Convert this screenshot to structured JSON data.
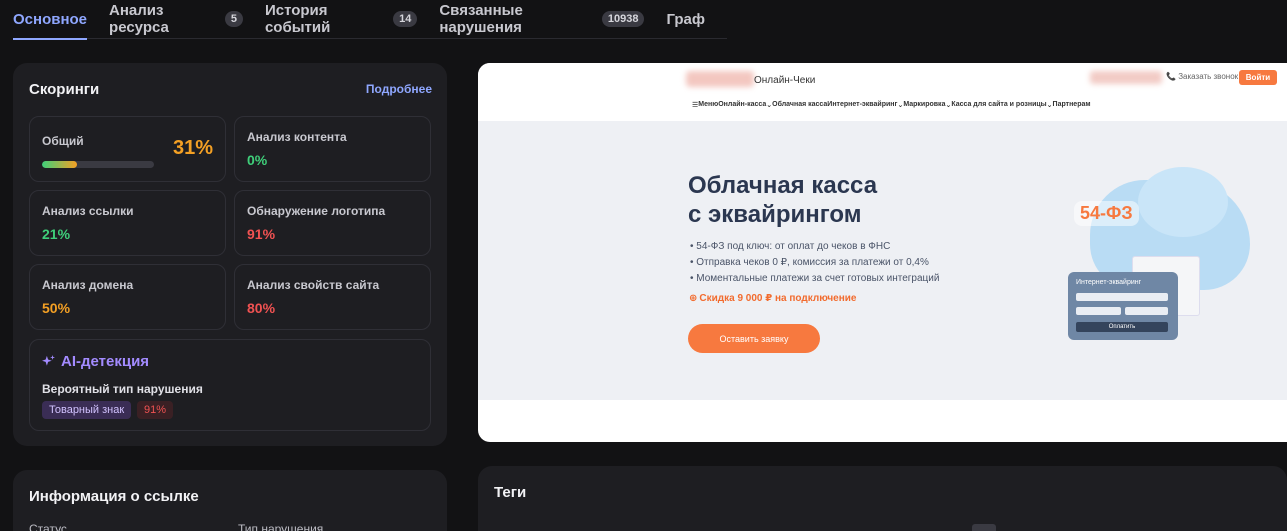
{
  "tabs": [
    {
      "label": "Основное",
      "count": null,
      "active": true
    },
    {
      "label": "Анализ ресурса",
      "count": "5"
    },
    {
      "label": "История событий",
      "count": "14"
    },
    {
      "label": "Связанные нарушения",
      "count": "10938"
    },
    {
      "label": "Граф",
      "count": null
    }
  ],
  "scoring": {
    "title": "Скоринги",
    "more_link": "Подробнее",
    "overall": {
      "label": "Общий",
      "value": "31%",
      "progress": 31
    },
    "content": {
      "label": "Анализ контента",
      "value": "0%"
    },
    "link": {
      "label": "Анализ ссылки",
      "value": "21%"
    },
    "logo": {
      "label": "Обнаружение логотипа",
      "value": "91%"
    },
    "domain": {
      "label": "Анализ домена",
      "value": "50%"
    },
    "site_props": {
      "label": "Анализ свойств сайта",
      "value": "80%"
    },
    "ai": {
      "title": "AI-детекция",
      "subtitle": "Вероятный тип нарушения",
      "type_chip": "Товарный знак",
      "pct_chip": "91%"
    }
  },
  "preview": {
    "logo_text": "Онлайн-Чеки",
    "call_label": "Заказать звонок",
    "enter_button": "Войти",
    "nav": [
      "Меню",
      "Онлайн-касса",
      "Облачная касса",
      "Интернет-эквайринг",
      "Маркировка",
      "Касса для сайта и розницы",
      "Партнерам"
    ],
    "headline_line1": "Облачная касса",
    "headline_line2": "с эквайрингом",
    "bullets": [
      "54-ФЗ под ключ: от оплат до чеков в ФНС",
      "Отправка чеков 0 ₽, комиссия за платежи от 0,4%",
      "Моментальные платежи за счет готовых интеграций"
    ],
    "discount": "Скидка 9 000 ₽ на подключение",
    "cta": "Оставить заявку",
    "badge_fz": "54-ФЗ",
    "terminal_title": "Интернет-эквайринг",
    "terminal_pay": "Оплатить"
  },
  "info": {
    "title": "Информация о ссылке",
    "status_label": "Статус",
    "type_label": "Тип нарушения"
  },
  "tags": {
    "title": "Теги"
  },
  "colors": {
    "accent": "#8fa7ff",
    "green": "#3fcf7a",
    "orange": "#f4a024",
    "red": "#f05252",
    "ai_purple": "#a38bff"
  }
}
